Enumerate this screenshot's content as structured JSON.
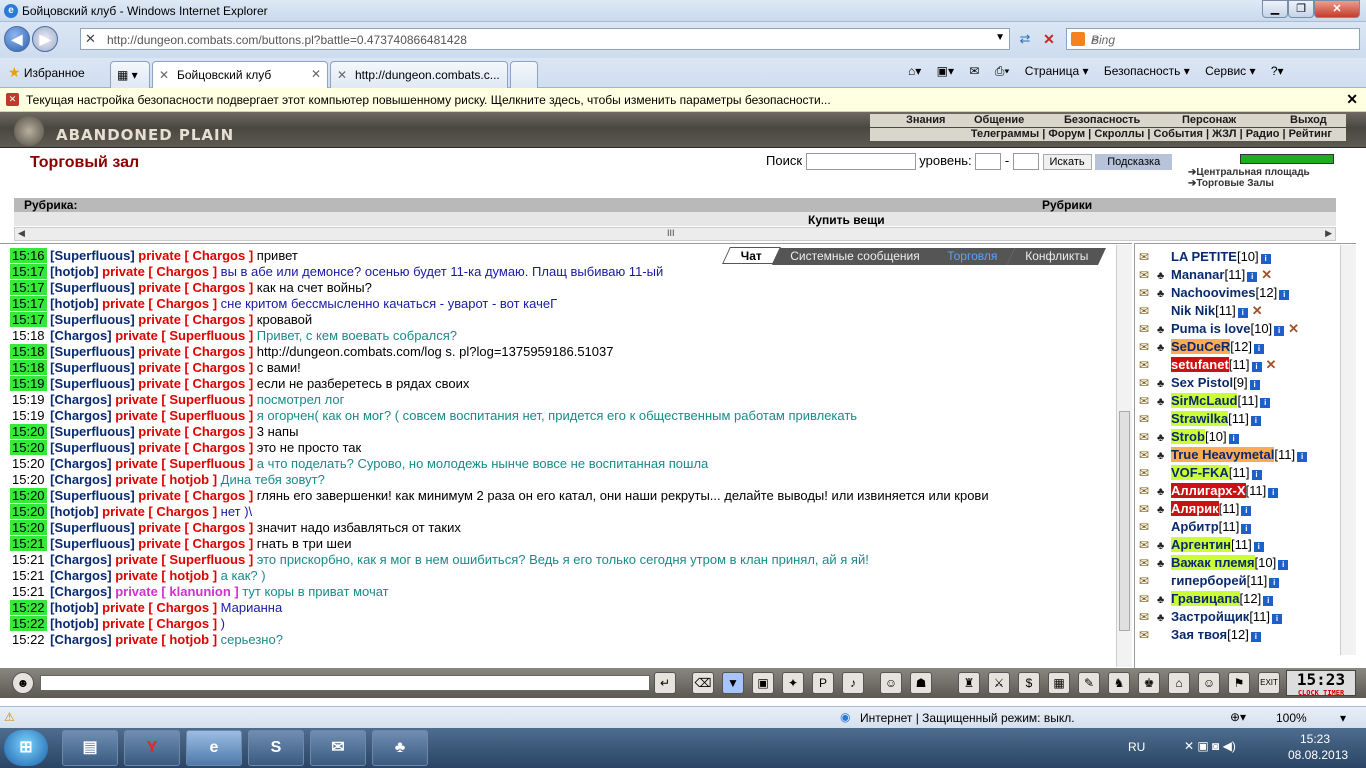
{
  "window": {
    "title": "Бойцовский клуб - Windows Internet Explorer"
  },
  "address": {
    "url": "http://dungeon.combats.com/buttons.pl?battle=0.473740866481428"
  },
  "search_box": {
    "placeholder": "Bing"
  },
  "favorites": {
    "label": "Избранное"
  },
  "tabs": [
    {
      "label": "Бойцовский клуб"
    },
    {
      "label": "http://dungeon.combats.c..."
    }
  ],
  "commands": {
    "page": "Страница ▾",
    "safety": "Безопасность ▾",
    "service": "Сервис ▾"
  },
  "security_bar": {
    "text": "Текущая настройка безопасности подвергает этот компьютер повышенному риску. Щелкните здесь, чтобы изменить параметры безопасности..."
  },
  "game": {
    "logo_text": "ABANDONED PLAIN",
    "menu_top": [
      "Знания",
      "Общение",
      "Безопасность",
      "Персонаж",
      "Выход"
    ],
    "menu_bottom": "Телеграммы | Форум | Скроллы | События | ЖЗЛ | Радио | Рейтинг",
    "shop_title": "Торговый зал",
    "search_label": "Поиск",
    "level_label": "уровень:",
    "level_dash": "-",
    "search_button": "Искать",
    "hint_button": "Подсказка",
    "nav_links": [
      "Центральная площадь",
      "Торговые Залы"
    ],
    "rubric_label": "Рубрика:",
    "rubric_right": "Рубрики",
    "buy_label": "Купить вещи",
    "hscroll_thumb": "III"
  },
  "chat_tabs": [
    "Чат",
    "Системные сообщения",
    "Торговля",
    "Конфликты"
  ],
  "chat": [
    {
      "time": "15:16",
      "green": true,
      "from": "[Superfluous]",
      "priv": "private [ Chargos ]",
      "cls": "mk",
      "text": "привет"
    },
    {
      "time": "15:17",
      "green": true,
      "from": "[hotjob]",
      "priv": "private [ Chargos ]",
      "cls": "mb",
      "text": "вы в абе или демонсе? осенью будет 11-ка думаю. Плащ выбиваю 11-ый"
    },
    {
      "time": "15:17",
      "green": true,
      "from": "[Superfluous]",
      "priv": "private [ Chargos ]",
      "cls": "mk",
      "text": "как на счет войны?"
    },
    {
      "time": "15:17",
      "green": true,
      "from": "[hotjob]",
      "priv": "private [ Chargos ]",
      "cls": "mb",
      "text": "сне критом бессмысленно качаться - уварот - вот качеГ"
    },
    {
      "time": "15:17",
      "green": true,
      "from": "[Superfluous]",
      "priv": "private [ Chargos ]",
      "cls": "mk",
      "text": "кровавой"
    },
    {
      "time": "15:18",
      "green": false,
      "from": "[Chargos]",
      "priv": "private [ Superfluous ]",
      "cls": "mt",
      "text": "Привет, с кем воевать собрался?"
    },
    {
      "time": "15:18",
      "green": true,
      "from": "[Superfluous]",
      "priv": "private [ Chargos ]",
      "cls": "mk",
      "text": "http://dungeon.combats.com/log s. pl?log=1375959186.51037"
    },
    {
      "time": "15:18",
      "green": true,
      "from": "[Superfluous]",
      "priv": "private [ Chargos ]",
      "cls": "mk",
      "text": "с вами!"
    },
    {
      "time": "15:19",
      "green": true,
      "from": "[Superfluous]",
      "priv": "private [ Chargos ]",
      "cls": "mk",
      "text": "если не разберетесь в рядах своих"
    },
    {
      "time": "15:19",
      "green": false,
      "from": "[Chargos]",
      "priv": "private [ Superfluous ]",
      "cls": "mt",
      "text": "посмотрел лог"
    },
    {
      "time": "15:19",
      "green": false,
      "from": "[Chargos]",
      "priv": "private [ Superfluous ]",
      "cls": "mt",
      "text": "я огорчен( как он мог? ( совсем воспитания нет, придется его к общественным работам привлекать"
    },
    {
      "time": "15:20",
      "green": true,
      "from": "[Superfluous]",
      "priv": "private [ Chargos ]",
      "cls": "mk",
      "text": "3 напы"
    },
    {
      "time": "15:20",
      "green": true,
      "from": "[Superfluous]",
      "priv": "private [ Chargos ]",
      "cls": "mk",
      "text": "это не просто так"
    },
    {
      "time": "15:20",
      "green": false,
      "from": "[Chargos]",
      "priv": "private [ Superfluous ]",
      "cls": "mt",
      "text": "а что поделать? Сурово, но молодежь нынче вовсе не воспитанная пошла"
    },
    {
      "time": "15:20",
      "green": false,
      "from": "[Chargos]",
      "priv": "private [ hotjob ]",
      "cls": "mt",
      "text": "Дина тебя зовут?"
    },
    {
      "time": "15:20",
      "green": true,
      "from": "[Superfluous]",
      "priv": "private [ Chargos ]",
      "cls": "mk",
      "text": "глянь его завершенки! как минимум 2 раза он его катал, они наши рекруты... делайте выводы! или извиняется или крови",
      "wrap": true
    },
    {
      "time": "15:20",
      "green": true,
      "from": "[hotjob]",
      "priv": "private [ Chargos ]",
      "cls": "mb",
      "text": "нет )\\"
    },
    {
      "time": "15:20",
      "green": true,
      "from": "[Superfluous]",
      "priv": "private [ Chargos ]",
      "cls": "mk",
      "text": "значит надо избавляться от таких"
    },
    {
      "time": "15:21",
      "green": true,
      "from": "[Superfluous]",
      "priv": "private [ Chargos ]",
      "cls": "mk",
      "text": "гнать в три шеи"
    },
    {
      "time": "15:21",
      "green": false,
      "from": "[Chargos]",
      "priv": "private [ Superfluous ]",
      "cls": "mt",
      "text": "это прискорбно, как я мог в нем ошибиться? Ведь я его только сегодня утром в клан принял, ай я яй!"
    },
    {
      "time": "15:21",
      "green": false,
      "from": "[Chargos]",
      "priv": "private [ hotjob ]",
      "cls": "mt",
      "text": "а как? )"
    },
    {
      "time": "15:21",
      "green": false,
      "from": "[Chargos]",
      "priv": "private [ klanunion ]",
      "purple": true,
      "cls": "mt",
      "text": "тут коры в приват мочат"
    },
    {
      "time": "15:22",
      "green": true,
      "from": "[hotjob]",
      "priv": "private [ Chargos ]",
      "cls": "mb",
      "text": "Марианна"
    },
    {
      "time": "15:22",
      "green": true,
      "from": "[hotjob]",
      "priv": "private [ Chargos ]",
      "cls": "mb",
      "text": ")"
    },
    {
      "time": "15:22",
      "green": false,
      "from": "[Chargos]",
      "priv": "private [ hotjob ]",
      "cls": "mt",
      "text": "серьезно?"
    }
  ],
  "users": [
    {
      "name": "LA PETITE",
      "lvl": "[10]",
      "bg": ""
    },
    {
      "name": "Mananar",
      "lvl": "[11]",
      "bg": "",
      "swords": true
    },
    {
      "name": "Nachoovimes",
      "lvl": "[12]",
      "bg": ""
    },
    {
      "name": "Nik Nik",
      "lvl": "[11]",
      "bg": "",
      "swords": true
    },
    {
      "name": "Puma is love",
      "lvl": "[10]",
      "bg": "",
      "swords": true
    },
    {
      "name": "SeDuCeR",
      "lvl": "[12]",
      "bg": "#ffaa55"
    },
    {
      "name": "setufanet",
      "lvl": "[11]",
      "bg": "#cc1111",
      "swords": true
    },
    {
      "name": "Sex Pistol",
      "lvl": "[9]",
      "bg": ""
    },
    {
      "name": "SirMcLaud",
      "lvl": "[11]",
      "bg": "#ccff33"
    },
    {
      "name": "Strawilka",
      "lvl": "[11]",
      "bg": "#ccff33"
    },
    {
      "name": "Strob",
      "lvl": "[10]",
      "bg": "#ccff33"
    },
    {
      "name": "True Heavymetal",
      "lvl": "[11]",
      "bg": "#ffaa55"
    },
    {
      "name": "VOF-FKA",
      "lvl": "[11]",
      "bg": "#ccff33"
    },
    {
      "name": "Аллигарх-X",
      "lvl": "[11]",
      "bg": "#cc1111"
    },
    {
      "name": "Алярик",
      "lvl": "[11]",
      "bg": "#cc1111"
    },
    {
      "name": "Арбитр",
      "lvl": "[11]",
      "bg": ""
    },
    {
      "name": "Аргентин",
      "lvl": "[11]",
      "bg": "#ccff33"
    },
    {
      "name": "Важак племя",
      "lvl": "[10]",
      "bg": "#ccff33"
    },
    {
      "name": "гиперборей",
      "lvl": "[11]",
      "bg": ""
    },
    {
      "name": "Гравицапа",
      "lvl": "[12]",
      "bg": "#ccff33"
    },
    {
      "name": "Застройщик",
      "lvl": "[11]",
      "bg": ""
    },
    {
      "name": "Зая твоя",
      "lvl": "[12]",
      "bg": ""
    }
  ],
  "clock": {
    "time": "15:23",
    "label1": "CLOCK",
    "label2": "TIMER"
  },
  "iestatus": {
    "zone": "Интернет | Защищенный режим: выкл.",
    "zoom": "100%"
  },
  "tray": {
    "lang": "RU",
    "time": "15:23",
    "date": "08.08.2013"
  },
  "colors": {
    "time_green": "#39e63c",
    "private_red": "#e00000",
    "nick_blue": "#0a2a6e"
  }
}
